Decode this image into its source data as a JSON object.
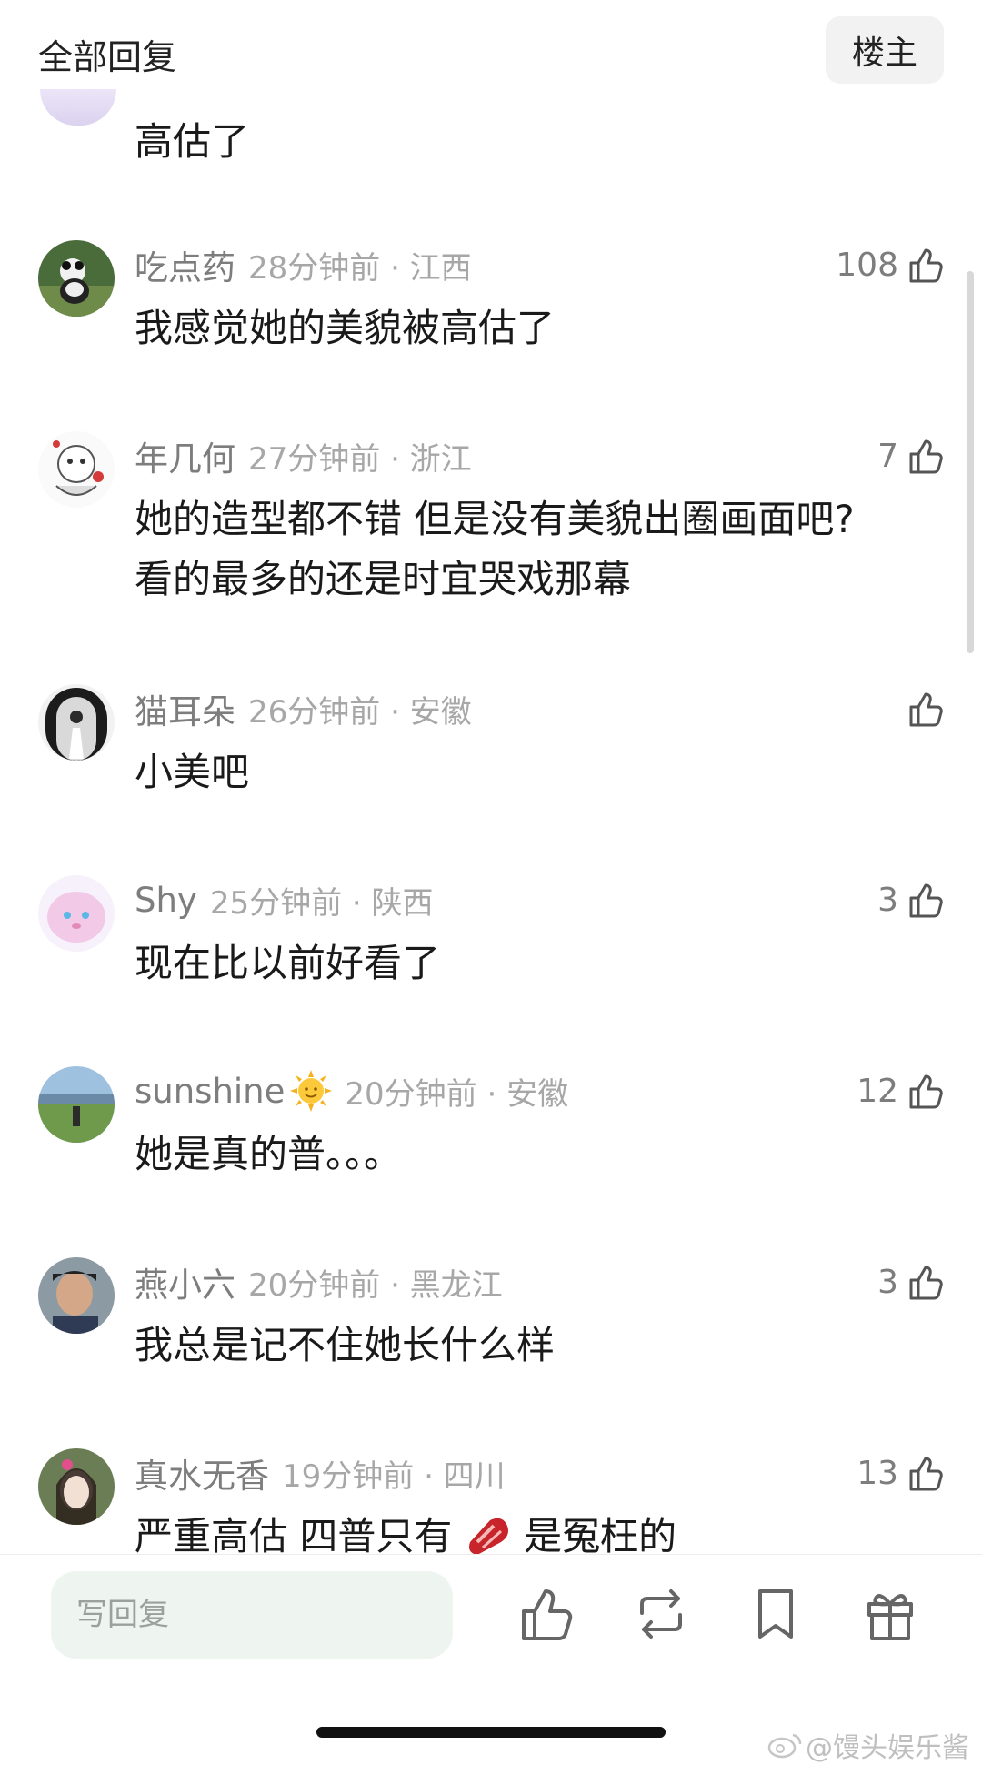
{
  "header": {
    "title": "全部回复",
    "host_button": "楼主"
  },
  "partial_comment": {
    "text": "高估了"
  },
  "comments": [
    {
      "user": "吃点药",
      "time": "28分钟前 · 江西",
      "text": [
        "我感觉她的美貌被高估了"
      ],
      "likes": "108",
      "avatar": "panda"
    },
    {
      "user": "年几何",
      "time": "27分钟前 · 浙江",
      "text": [
        "她的造型都不错 但是没有美貌出圈画面吧?",
        "看的最多的还是时宜哭戏那幕"
      ],
      "likes": "7",
      "avatar": "sketch"
    },
    {
      "user": "猫耳朵",
      "time": "26分钟前 · 安徽",
      "text": [
        "小美吧"
      ],
      "likes": "",
      "avatar": "doorway"
    },
    {
      "user": "Shy",
      "time": "25分钟前 · 陕西",
      "text": [
        "现在比以前好看了"
      ],
      "likes": "3",
      "avatar": "pink-blob"
    },
    {
      "user": "sunshine",
      "time": "20分钟前 · 安徽",
      "text": [
        "她是真的普。。。"
      ],
      "likes": "12",
      "avatar": "landscape",
      "badge": "sun-emoji"
    },
    {
      "user": "燕小六",
      "time": "20分钟前 · 黑龙江",
      "text": [
        "我总是记不住她长什么样"
      ],
      "likes": "3",
      "avatar": "man"
    },
    {
      "user": "真水无香",
      "time": "19分钟前 · 四川",
      "text_parts": [
        "严重高估 四普只有",
        "是冤枉的"
      ],
      "text_emoji": "steak-emoji",
      "likes": "13",
      "avatar": "woman-flower"
    }
  ],
  "bottom_bar": {
    "reply_placeholder": "写回复",
    "icons": [
      "like-icon",
      "repost-icon",
      "bookmark-icon",
      "gift-icon"
    ]
  },
  "watermark": "@馒头娱乐酱",
  "colors": {
    "meta_text": "#8e8e8e",
    "input_bg": "#eef5f0",
    "host_bg": "#f2f2f2"
  }
}
